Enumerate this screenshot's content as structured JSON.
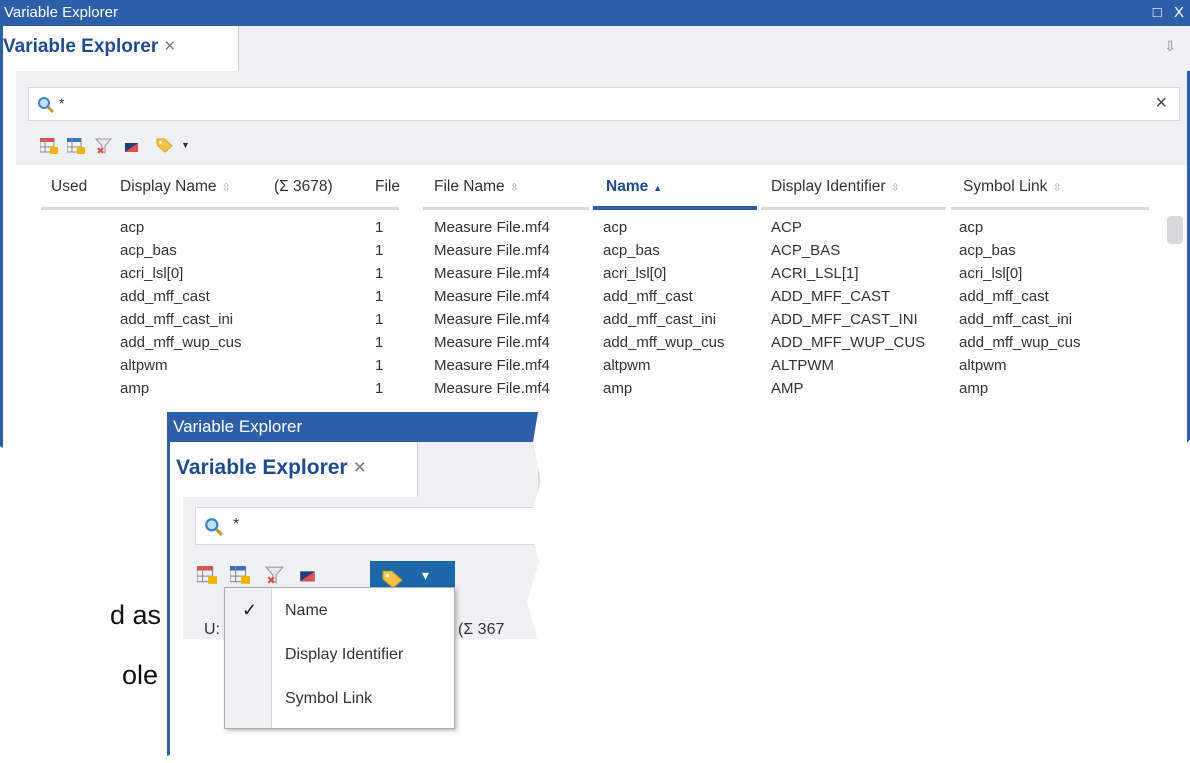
{
  "main": {
    "window_title": "Variable Explorer",
    "maximize_glyph": "□",
    "close_glyph": "X",
    "tab_label": "Variable Explorer",
    "tab_close": "×",
    "tab_menu_glyph": "⇩",
    "search_value": "*",
    "search_clear": "×",
    "columns": {
      "used": "Used",
      "display_name": "Display Name",
      "count": "(Σ 3678)",
      "file": "File",
      "file_name": "File Name",
      "name": "Name",
      "display_identifier": "Display Identifier",
      "symbol_link": "Symbol Link"
    },
    "sort_neutral": "⇳",
    "sort_asc": "▲",
    "rows": [
      {
        "display_name": "acp",
        "file": "1",
        "file_name": "Measure File.mf4",
        "name": "acp",
        "display_identifier": "ACP",
        "symbol_link": "acp"
      },
      {
        "display_name": "acp_bas",
        "file": "1",
        "file_name": "Measure File.mf4",
        "name": "acp_bas",
        "display_identifier": "ACP_BAS",
        "symbol_link": "acp_bas"
      },
      {
        "display_name": "acri_lsl[0]",
        "file": "1",
        "file_name": "Measure File.mf4",
        "name": "acri_lsl[0]",
        "display_identifier": "ACRI_LSL[1]",
        "symbol_link": "acri_lsl[0]"
      },
      {
        "display_name": "add_mff_cast",
        "file": "1",
        "file_name": "Measure File.mf4",
        "name": "add_mff_cast",
        "display_identifier": "ADD_MFF_CAST",
        "symbol_link": "add_mff_cast"
      },
      {
        "display_name": "add_mff_cast_ini",
        "file": "1",
        "file_name": "Measure File.mf4",
        "name": "add_mff_cast_ini",
        "display_identifier": "ADD_MFF_CAST_INI",
        "symbol_link": "add_mff_cast_ini"
      },
      {
        "display_name": "add_mff_wup_cus",
        "file": "1",
        "file_name": "Measure File.mf4",
        "name": "add_mff_wup_cus",
        "display_identifier": "ADD_MFF_WUP_CUS",
        "symbol_link": "add_mff_wup_cus"
      },
      {
        "display_name": "altpwm",
        "file": "1",
        "file_name": "Measure File.mf4",
        "name": "altpwm",
        "display_identifier": "ALTPWM",
        "symbol_link": "altpwm"
      },
      {
        "display_name": "amp",
        "file": "1",
        "file_name": "Measure File.mf4",
        "name": "amp",
        "display_identifier": "AMP",
        "symbol_link": "amp"
      }
    ]
  },
  "overlay": {
    "window_title": "Variable Explorer",
    "tab_label": "Variable Explorer",
    "tab_close": "×",
    "search_value": "*",
    "used_partial": "U:",
    "count_partial": "(Σ 367",
    "tag_dropdown_glyph": "▾"
  },
  "menu": {
    "check_glyph": "✓",
    "items": [
      {
        "label": "Name",
        "checked": true
      },
      {
        "label": "Display Identifier",
        "checked": false
      },
      {
        "label": "Symbol Link",
        "checked": false
      }
    ]
  },
  "background_text": {
    "line1": "d as",
    "line2": "ole"
  },
  "icons": {
    "search": "search-icon",
    "toolbar": [
      "grid-add-icon",
      "grid-select-icon",
      "filter-clear-icon",
      "display-icon",
      "tag-icon"
    ]
  },
  "colors": {
    "title_bar": "#2d5ea8",
    "tab_text": "#1f4c8f",
    "menu_button": "#1e67a8"
  }
}
